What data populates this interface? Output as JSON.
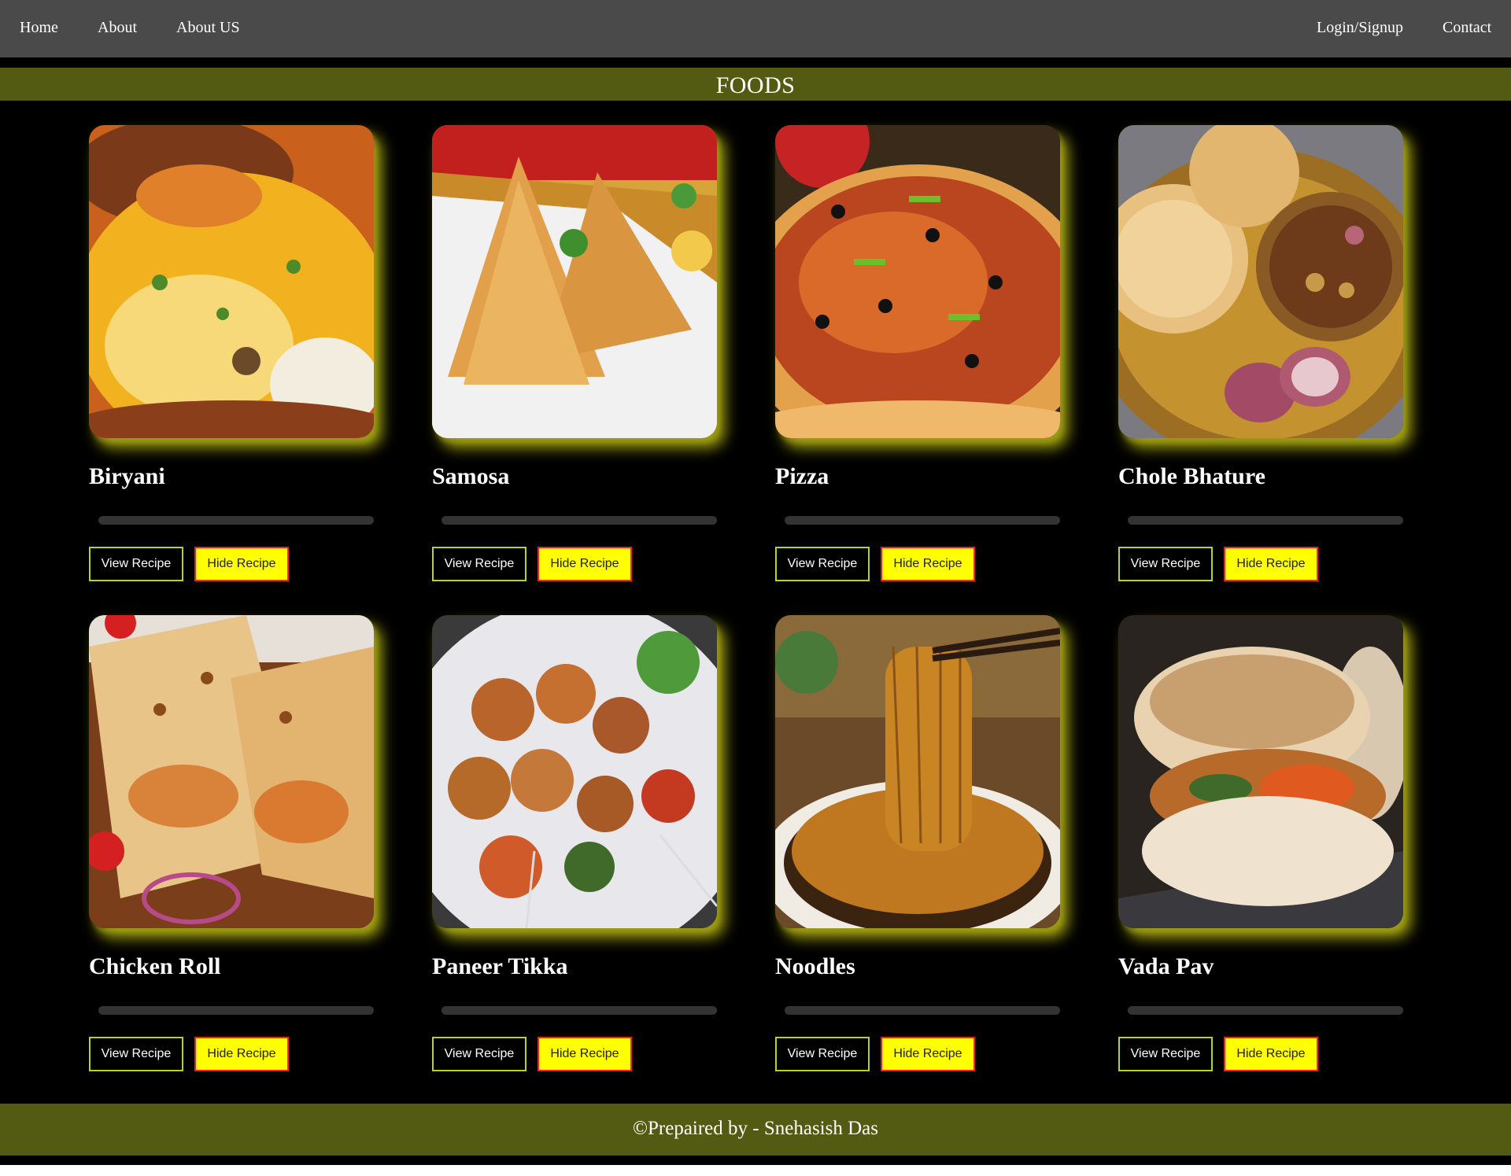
{
  "nav": {
    "left": [
      "Home",
      "About",
      "About US"
    ],
    "right": [
      "Login/Signup",
      "Contact"
    ]
  },
  "banner": {
    "title": "FOODS"
  },
  "buttons": {
    "view": "View Recipe",
    "hide": "Hide Recipe"
  },
  "foods": [
    {
      "name": "Biryani",
      "image": "biryani-photo",
      "progress": 0
    },
    {
      "name": "Samosa",
      "image": "samosa-photo",
      "progress": 0
    },
    {
      "name": "Pizza",
      "image": "pizza-photo",
      "progress": 0
    },
    {
      "name": "Chole Bhature",
      "image": "chole-bhature-photo",
      "progress": 0
    },
    {
      "name": "Chicken Roll",
      "image": "chicken-roll-photo",
      "progress": 0
    },
    {
      "name": "Paneer Tikka",
      "image": "paneer-tikka-photo",
      "progress": 0
    },
    {
      "name": "Noodles",
      "image": "noodles-photo",
      "progress": 0
    },
    {
      "name": "Vada Pav",
      "image": "vada-pav-photo",
      "progress": 0
    }
  ],
  "footer": {
    "text": "©Prepaired by - Snehasish Das"
  },
  "colors": {
    "navbar": "#4a4a4a",
    "banner": "#535b13",
    "view_border": "#b8d422",
    "hide_bg": "#ffff00",
    "hide_border": "#ff1a1a",
    "glow": "#a3a314"
  }
}
